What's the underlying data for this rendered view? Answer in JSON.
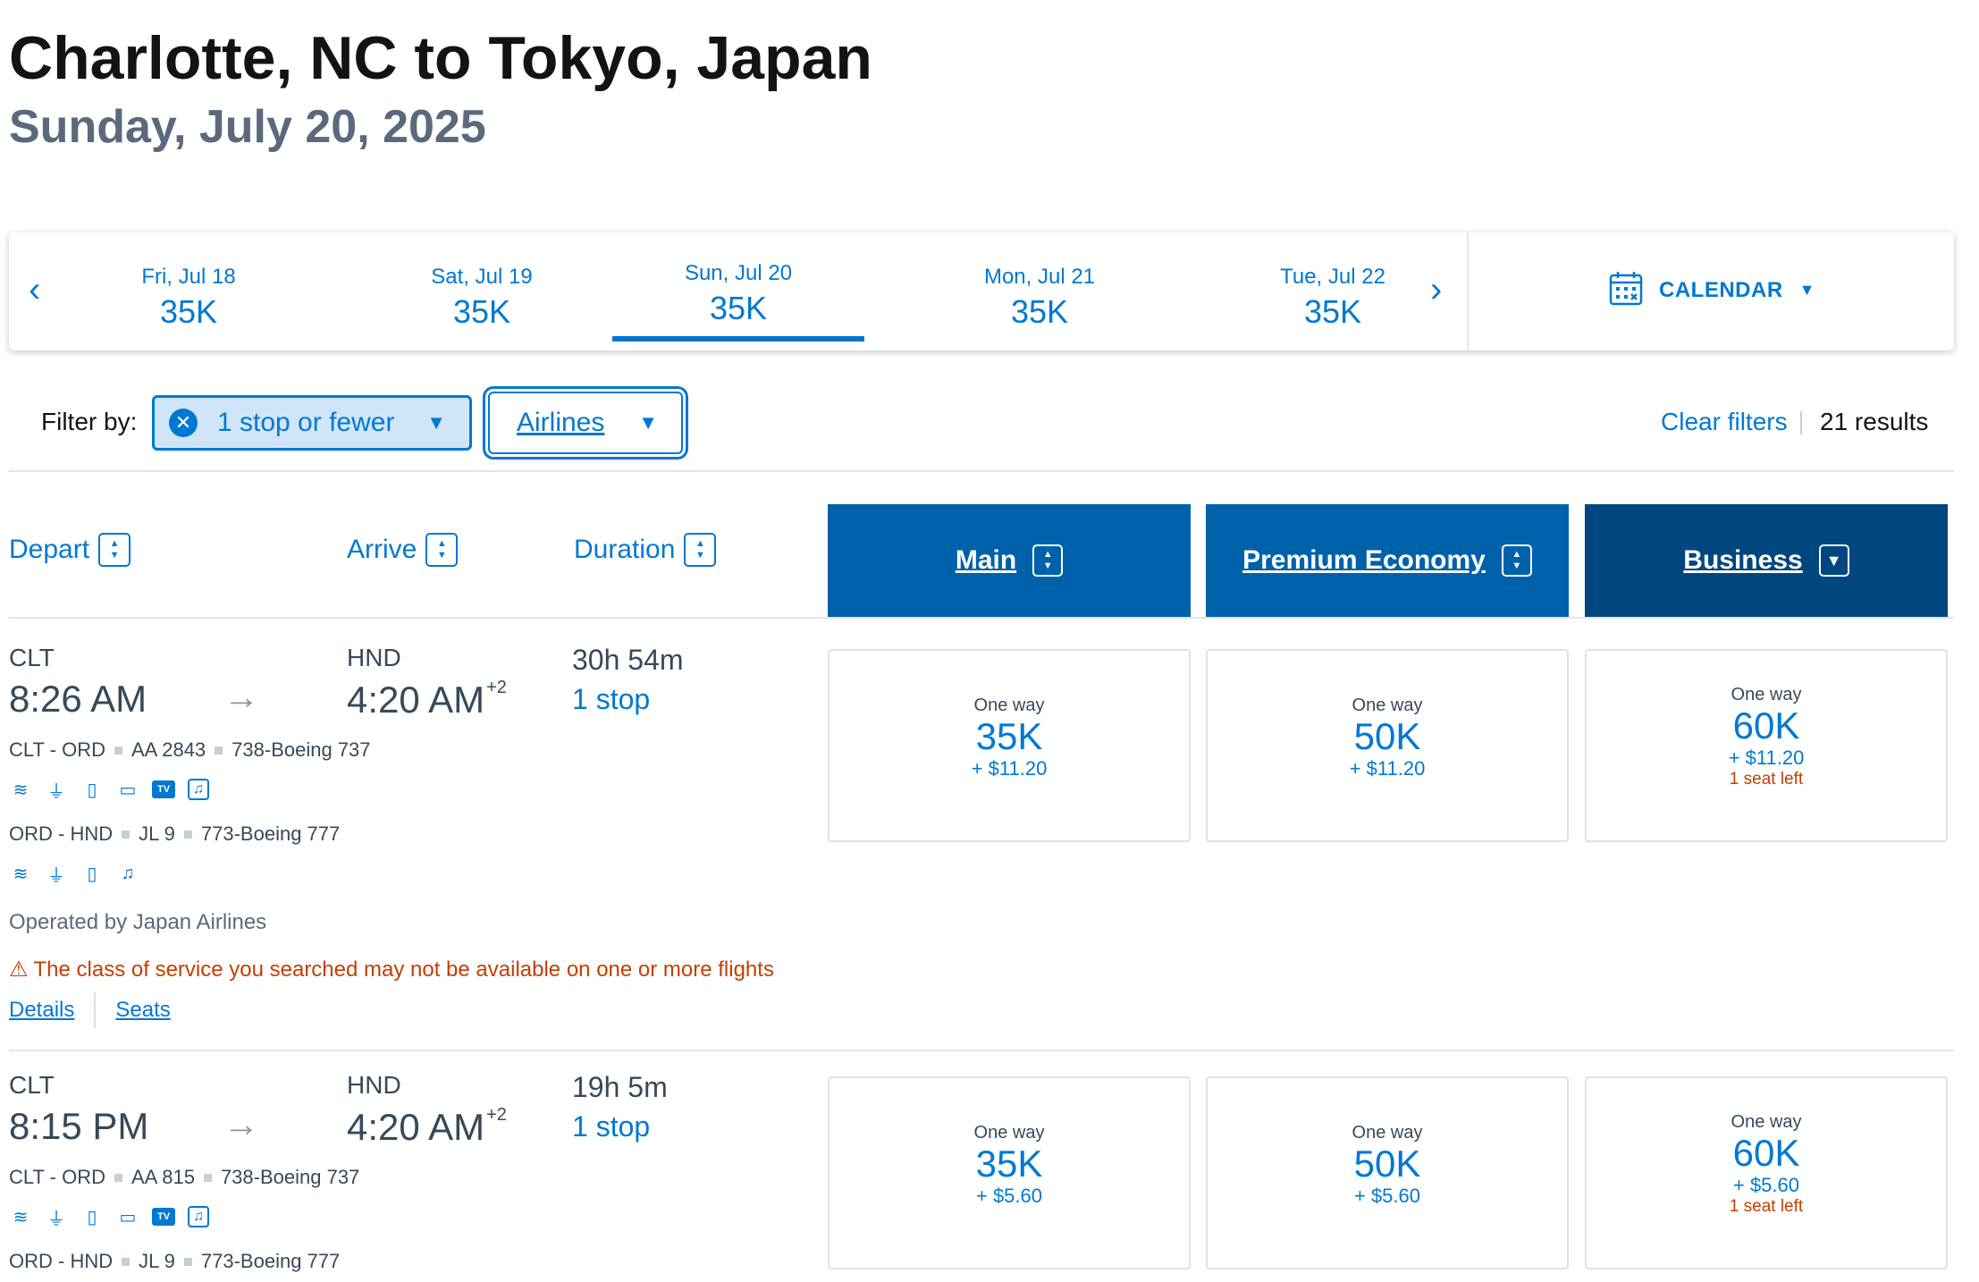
{
  "header": {
    "title": "Charlotte, NC to Tokyo, Japan",
    "subtitle": "Sunday, July 20, 2025"
  },
  "datebar": {
    "prev_icon": "chevron-left-icon",
    "next_icon": "chevron-right-icon",
    "dates": [
      {
        "label": "Fri, Jul 18",
        "price": "35K",
        "selected": false
      },
      {
        "label": "Sat, Jul 19",
        "price": "35K",
        "selected": false
      },
      {
        "label": "Sun, Jul 20",
        "price": "35K",
        "selected": true
      },
      {
        "label": "Mon, Jul 21",
        "price": "35K",
        "selected": false
      },
      {
        "label": "Tue, Jul 22",
        "price": "35K",
        "selected": false
      }
    ],
    "calendar_label": "CALENDAR",
    "calendar_icon": "calendar-icon"
  },
  "filters": {
    "label": "Filter by:",
    "stops_chip": "1 stop or fewer",
    "airlines_chip": "Airlines",
    "clear_label": "Clear filters",
    "results": "21 results"
  },
  "columns": {
    "depart": "Depart",
    "arrive": "Arrive",
    "duration": "Duration",
    "main": "Main",
    "premium": "Premium Economy",
    "business": "Business"
  },
  "colors": {
    "accent": "#0078d2",
    "cabin_header": "#0061ab",
    "business_header": "#00467f",
    "warning": "#c43e00"
  },
  "flights": [
    {
      "origin": "CLT",
      "depart_time": "8:26 AM",
      "destination": "HND",
      "arrive_time": "4:20 AM",
      "day_offset": "+2",
      "duration": "30h 54m",
      "stops": "1 stop",
      "segments": [
        {
          "route": "CLT - ORD",
          "flight": "AA 2843",
          "aircraft": "738-Boeing 737"
        },
        {
          "route": "ORD - HND",
          "flight": "JL 9",
          "aircraft": "773-Boeing 777"
        }
      ],
      "operated_by": "Operated by Japan Airlines",
      "warning": "The class of service you searched may not be available on one or more flights",
      "details_link": "Details",
      "seats_link": "Seats",
      "fares": {
        "main": {
          "label": "One way",
          "points": "35K",
          "tax": "+ $11.20"
        },
        "premium": {
          "label": "One way",
          "points": "50K",
          "tax": "+ $11.20"
        },
        "business": {
          "label": "One way",
          "points": "60K",
          "tax": "+ $11.20",
          "seats_left": "1 seat left"
        }
      }
    },
    {
      "origin": "CLT",
      "depart_time": "8:15 PM",
      "destination": "HND",
      "arrive_time": "4:20 AM",
      "day_offset": "+2",
      "duration": "19h 5m",
      "stops": "1 stop",
      "segments": [
        {
          "route": "CLT - ORD",
          "flight": "AA 815",
          "aircraft": "738-Boeing 737"
        },
        {
          "route": "ORD - HND",
          "flight": "JL 9",
          "aircraft": "773-Boeing 777"
        }
      ],
      "fares": {
        "main": {
          "label": "One way",
          "points": "35K",
          "tax": "+ $5.60"
        },
        "premium": {
          "label": "One way",
          "points": "50K",
          "tax": "+ $5.60"
        },
        "business": {
          "label": "One way",
          "points": "60K",
          "tax": "+ $5.60",
          "seats_left": "1 seat left"
        }
      }
    }
  ]
}
